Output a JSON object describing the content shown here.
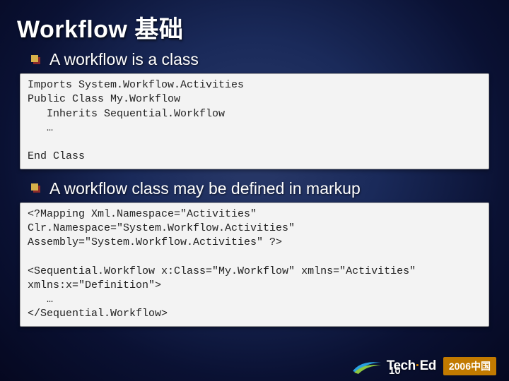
{
  "title": "Workflow 基础",
  "bullets": [
    "A workflow is a class",
    "A workflow class may be defined in markup"
  ],
  "code_blocks": [
    "Imports System.Workflow.Activities\nPublic Class My.Workflow\n   Inherits Sequential.Workflow\n   …\n\nEnd Class",
    "<?Mapping Xml.Namespace=\"Activities\" Clr.Namespace=\"System.Workflow.Activities\" Assembly=\"System.Workflow.Activities\" ?>\n\n<Sequential.Workflow x:Class=\"My.Workflow\" xmlns=\"Activities\" xmlns:x=\"Definition\">\n   …\n</Sequential.Workflow>"
  ],
  "brand": {
    "name_pre": "Tech",
    "name_dot": "·",
    "name_post": "Ed",
    "year_label": "2006中国"
  },
  "page_number": "10"
}
